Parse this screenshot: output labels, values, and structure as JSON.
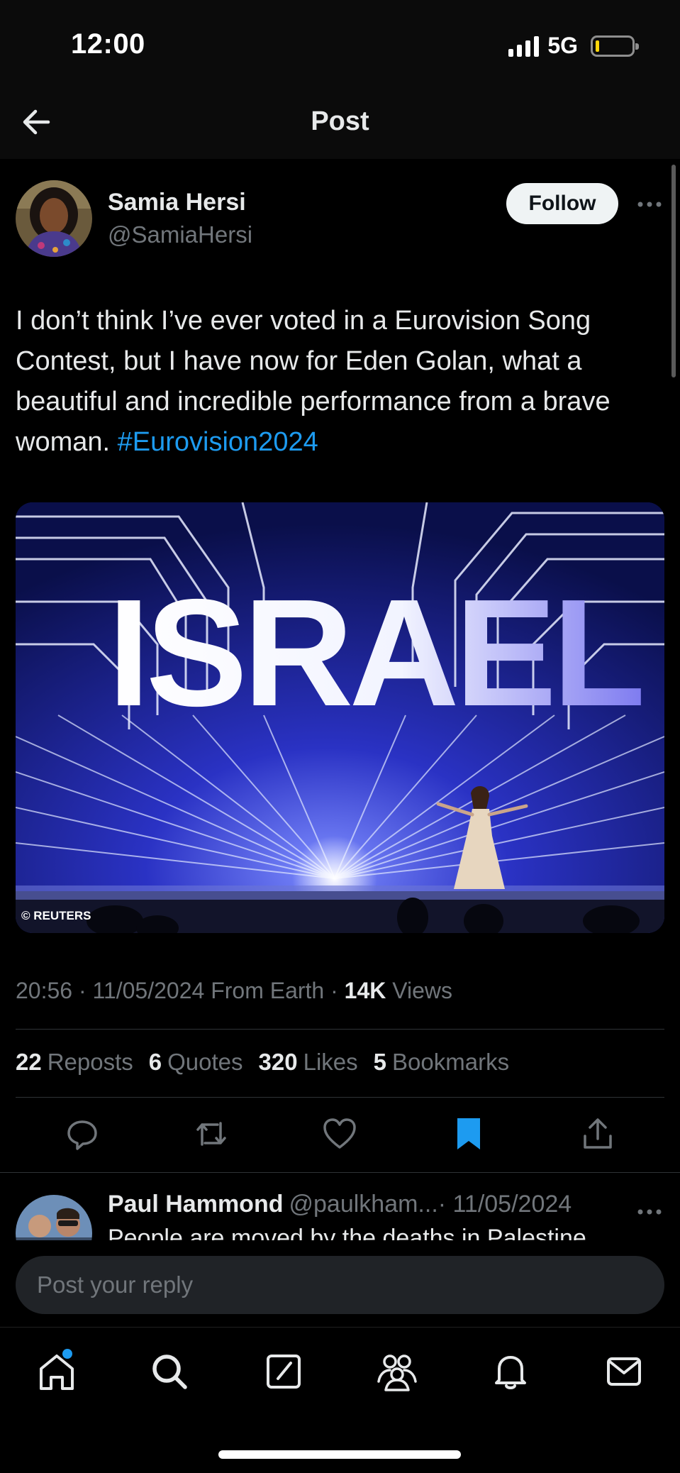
{
  "status_bar": {
    "time": "12:00",
    "network": "5G",
    "battery_level": 0.1
  },
  "header": {
    "title": "Post",
    "back_icon": "arrow-left-icon"
  },
  "post": {
    "author_name": "Samia Hersi",
    "author_handle": "@SamiaHersi",
    "follow_label": "Follow",
    "text": "I don’t think I’ve ever voted in a Eurovision Song Contest, but I have now for Eden Golan, what a beautiful and incredible performance from a brave woman.",
    "hashtag": "#Eurovision2024",
    "media": {
      "stage_text": "ISRAEL",
      "credit": "© REUTERS"
    },
    "time": "20:56",
    "date": "11/05/2024",
    "source": "From Earth",
    "views_count": "14K",
    "views_label": "Views",
    "stats": {
      "reposts_count": "22",
      "reposts_label": "Reposts",
      "quotes_count": "6",
      "quotes_label": "Quotes",
      "likes_count": "320",
      "likes_label": "Likes",
      "bookmarks_count": "5",
      "bookmarks_label": "Bookmarks"
    },
    "actions": [
      "reply-icon",
      "repost-icon",
      "like-icon",
      "bookmark-icon",
      "share-icon"
    ],
    "bookmarked": true
  },
  "reply_preview": {
    "author_name": "Paul Hammond",
    "author_handle": "@paulkham...",
    "date": "· 11/05/2024",
    "text": "People are moved by the deaths in Palestine"
  },
  "reply_bar": {
    "placeholder": "Post your reply"
  },
  "bottom_nav": [
    "home-icon",
    "search-icon",
    "compose-icon",
    "communities-icon",
    "notifications-icon",
    "messages-icon"
  ],
  "colors": {
    "accent": "#1d9bf0",
    "background": "#000000",
    "muted": "#71767b",
    "text": "#e7e9ea"
  }
}
